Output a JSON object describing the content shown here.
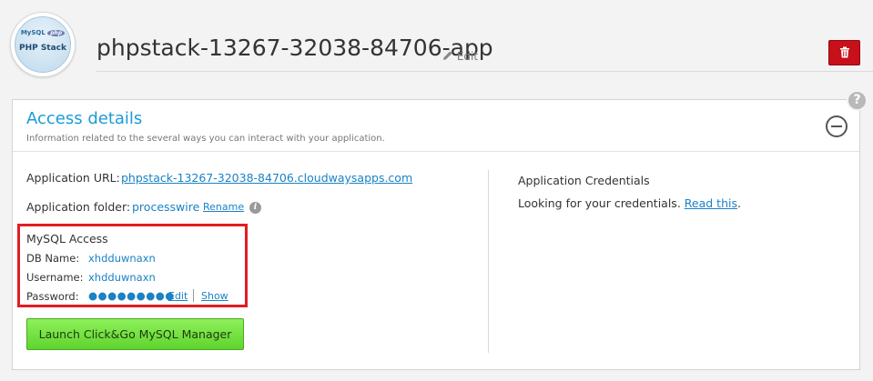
{
  "app": {
    "logo_brand_mysql": "MySQL",
    "logo_brand_php": "php",
    "logo_text": "PHP Stack",
    "name": "phpstack-13267-32038-84706-app",
    "edit_label": "Edit"
  },
  "panel": {
    "title": "Access details",
    "description": "Information related to the several ways you can interact with your application."
  },
  "access": {
    "url_label": "Application URL:",
    "url_value": "phpstack-13267-32038-84706.cloudwaysapps.com",
    "folder_label": "Application folder:",
    "folder_value": "processwire",
    "rename_label": "Rename"
  },
  "mysql": {
    "heading": "MySQL Access",
    "db_name_label": "DB Name:",
    "db_name_value": "xhdduwnaxn",
    "username_label": "Username:",
    "username_value": "xhdduwnaxn",
    "password_label": "Password:",
    "password_mask": "●●●●●●●●●",
    "edit_label": "Edit",
    "show_label": "Show",
    "launch_button": "Launch Click&Go MySQL Manager"
  },
  "credentials": {
    "title": "Application Credentials",
    "text": "Looking for your credentials.",
    "link": "Read this",
    "trailing": "."
  },
  "colors": {
    "accent_blue": "#1a9bd7",
    "link_blue": "#1a82c5",
    "delete_red": "#c8101a",
    "highlight_red": "#e31b23",
    "launch_green": "#6fdc3a"
  },
  "icons": [
    "pencil-icon",
    "trash-icon",
    "help-icon",
    "collapse-icon",
    "info-icon"
  ]
}
